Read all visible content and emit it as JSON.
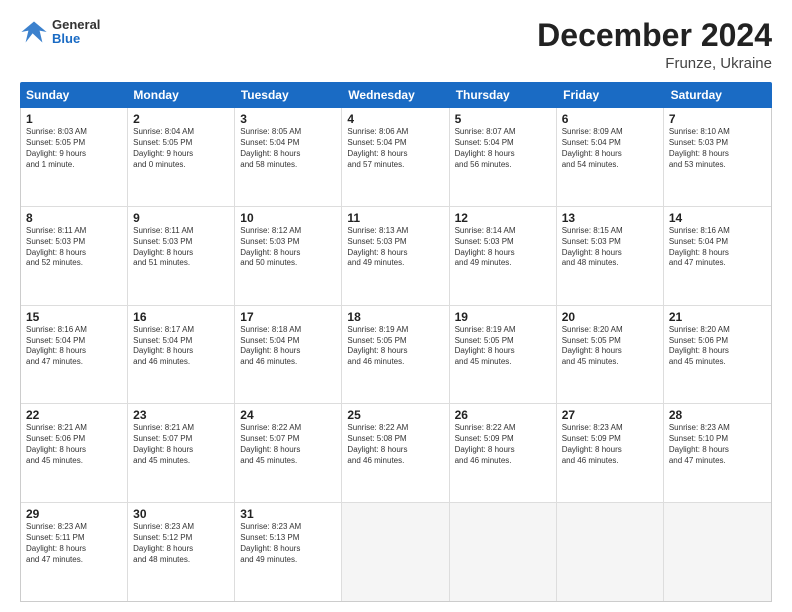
{
  "logo": {
    "general": "General",
    "blue": "Blue"
  },
  "title": {
    "month": "December 2024",
    "location": "Frunze, Ukraine"
  },
  "calendar": {
    "days_of_week": [
      "Sunday",
      "Monday",
      "Tuesday",
      "Wednesday",
      "Thursday",
      "Friday",
      "Saturday"
    ],
    "rows": [
      [
        {
          "day": "1",
          "lines": [
            "Sunrise: 8:03 AM",
            "Sunset: 5:05 PM",
            "Daylight: 9 hours",
            "and 1 minute."
          ]
        },
        {
          "day": "2",
          "lines": [
            "Sunrise: 8:04 AM",
            "Sunset: 5:05 PM",
            "Daylight: 9 hours",
            "and 0 minutes."
          ]
        },
        {
          "day": "3",
          "lines": [
            "Sunrise: 8:05 AM",
            "Sunset: 5:04 PM",
            "Daylight: 8 hours",
            "and 58 minutes."
          ]
        },
        {
          "day": "4",
          "lines": [
            "Sunrise: 8:06 AM",
            "Sunset: 5:04 PM",
            "Daylight: 8 hours",
            "and 57 minutes."
          ]
        },
        {
          "day": "5",
          "lines": [
            "Sunrise: 8:07 AM",
            "Sunset: 5:04 PM",
            "Daylight: 8 hours",
            "and 56 minutes."
          ]
        },
        {
          "day": "6",
          "lines": [
            "Sunrise: 8:09 AM",
            "Sunset: 5:04 PM",
            "Daylight: 8 hours",
            "and 54 minutes."
          ]
        },
        {
          "day": "7",
          "lines": [
            "Sunrise: 8:10 AM",
            "Sunset: 5:03 PM",
            "Daylight: 8 hours",
            "and 53 minutes."
          ]
        }
      ],
      [
        {
          "day": "8",
          "lines": [
            "Sunrise: 8:11 AM",
            "Sunset: 5:03 PM",
            "Daylight: 8 hours",
            "and 52 minutes."
          ]
        },
        {
          "day": "9",
          "lines": [
            "Sunrise: 8:11 AM",
            "Sunset: 5:03 PM",
            "Daylight: 8 hours",
            "and 51 minutes."
          ]
        },
        {
          "day": "10",
          "lines": [
            "Sunrise: 8:12 AM",
            "Sunset: 5:03 PM",
            "Daylight: 8 hours",
            "and 50 minutes."
          ]
        },
        {
          "day": "11",
          "lines": [
            "Sunrise: 8:13 AM",
            "Sunset: 5:03 PM",
            "Daylight: 8 hours",
            "and 49 minutes."
          ]
        },
        {
          "day": "12",
          "lines": [
            "Sunrise: 8:14 AM",
            "Sunset: 5:03 PM",
            "Daylight: 8 hours",
            "and 49 minutes."
          ]
        },
        {
          "day": "13",
          "lines": [
            "Sunrise: 8:15 AM",
            "Sunset: 5:03 PM",
            "Daylight: 8 hours",
            "and 48 minutes."
          ]
        },
        {
          "day": "14",
          "lines": [
            "Sunrise: 8:16 AM",
            "Sunset: 5:04 PM",
            "Daylight: 8 hours",
            "and 47 minutes."
          ]
        }
      ],
      [
        {
          "day": "15",
          "lines": [
            "Sunrise: 8:16 AM",
            "Sunset: 5:04 PM",
            "Daylight: 8 hours",
            "and 47 minutes."
          ]
        },
        {
          "day": "16",
          "lines": [
            "Sunrise: 8:17 AM",
            "Sunset: 5:04 PM",
            "Daylight: 8 hours",
            "and 46 minutes."
          ]
        },
        {
          "day": "17",
          "lines": [
            "Sunrise: 8:18 AM",
            "Sunset: 5:04 PM",
            "Daylight: 8 hours",
            "and 46 minutes."
          ]
        },
        {
          "day": "18",
          "lines": [
            "Sunrise: 8:19 AM",
            "Sunset: 5:05 PM",
            "Daylight: 8 hours",
            "and 46 minutes."
          ]
        },
        {
          "day": "19",
          "lines": [
            "Sunrise: 8:19 AM",
            "Sunset: 5:05 PM",
            "Daylight: 8 hours",
            "and 45 minutes."
          ]
        },
        {
          "day": "20",
          "lines": [
            "Sunrise: 8:20 AM",
            "Sunset: 5:05 PM",
            "Daylight: 8 hours",
            "and 45 minutes."
          ]
        },
        {
          "day": "21",
          "lines": [
            "Sunrise: 8:20 AM",
            "Sunset: 5:06 PM",
            "Daylight: 8 hours",
            "and 45 minutes."
          ]
        }
      ],
      [
        {
          "day": "22",
          "lines": [
            "Sunrise: 8:21 AM",
            "Sunset: 5:06 PM",
            "Daylight: 8 hours",
            "and 45 minutes."
          ]
        },
        {
          "day": "23",
          "lines": [
            "Sunrise: 8:21 AM",
            "Sunset: 5:07 PM",
            "Daylight: 8 hours",
            "and 45 minutes."
          ]
        },
        {
          "day": "24",
          "lines": [
            "Sunrise: 8:22 AM",
            "Sunset: 5:07 PM",
            "Daylight: 8 hours",
            "and 45 minutes."
          ]
        },
        {
          "day": "25",
          "lines": [
            "Sunrise: 8:22 AM",
            "Sunset: 5:08 PM",
            "Daylight: 8 hours",
            "and 46 minutes."
          ]
        },
        {
          "day": "26",
          "lines": [
            "Sunrise: 8:22 AM",
            "Sunset: 5:09 PM",
            "Daylight: 8 hours",
            "and 46 minutes."
          ]
        },
        {
          "day": "27",
          "lines": [
            "Sunrise: 8:23 AM",
            "Sunset: 5:09 PM",
            "Daylight: 8 hours",
            "and 46 minutes."
          ]
        },
        {
          "day": "28",
          "lines": [
            "Sunrise: 8:23 AM",
            "Sunset: 5:10 PM",
            "Daylight: 8 hours",
            "and 47 minutes."
          ]
        }
      ],
      [
        {
          "day": "29",
          "lines": [
            "Sunrise: 8:23 AM",
            "Sunset: 5:11 PM",
            "Daylight: 8 hours",
            "and 47 minutes."
          ]
        },
        {
          "day": "30",
          "lines": [
            "Sunrise: 8:23 AM",
            "Sunset: 5:12 PM",
            "Daylight: 8 hours",
            "and 48 minutes."
          ]
        },
        {
          "day": "31",
          "lines": [
            "Sunrise: 8:23 AM",
            "Sunset: 5:13 PM",
            "Daylight: 8 hours",
            "and 49 minutes."
          ]
        },
        {
          "day": "",
          "lines": []
        },
        {
          "day": "",
          "lines": []
        },
        {
          "day": "",
          "lines": []
        },
        {
          "day": "",
          "lines": []
        }
      ]
    ]
  }
}
